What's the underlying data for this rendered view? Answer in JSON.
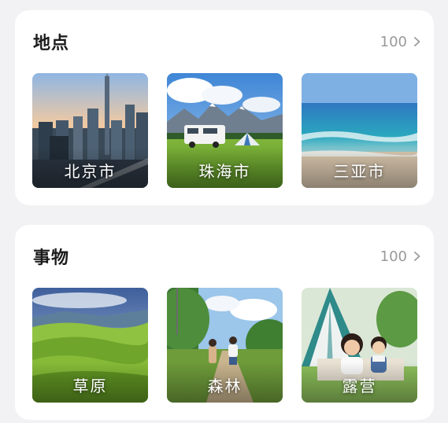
{
  "sections": [
    {
      "title": "地点",
      "count": "100",
      "items": [
        {
          "label": "北京市",
          "image": "beijing-city-skyline-photo"
        },
        {
          "label": "珠海市",
          "image": "camper-van-mountains-photo"
        },
        {
          "label": "三亚市",
          "image": "ocean-beach-photo"
        }
      ]
    },
    {
      "title": "事物",
      "count": "100",
      "items": [
        {
          "label": "草原",
          "image": "green-grassland-hills-photo"
        },
        {
          "label": "森林",
          "image": "forest-path-walkers-photo"
        },
        {
          "label": "露营",
          "image": "camping-tent-family-photo"
        }
      ]
    }
  ],
  "icons": {
    "more": "chevron-right-icon"
  },
  "colors": {
    "background": "#f2f2f4",
    "card": "#ffffff",
    "title": "#1c1c1c",
    "count": "#9a9a9a",
    "tile_label": "#ffffff"
  }
}
